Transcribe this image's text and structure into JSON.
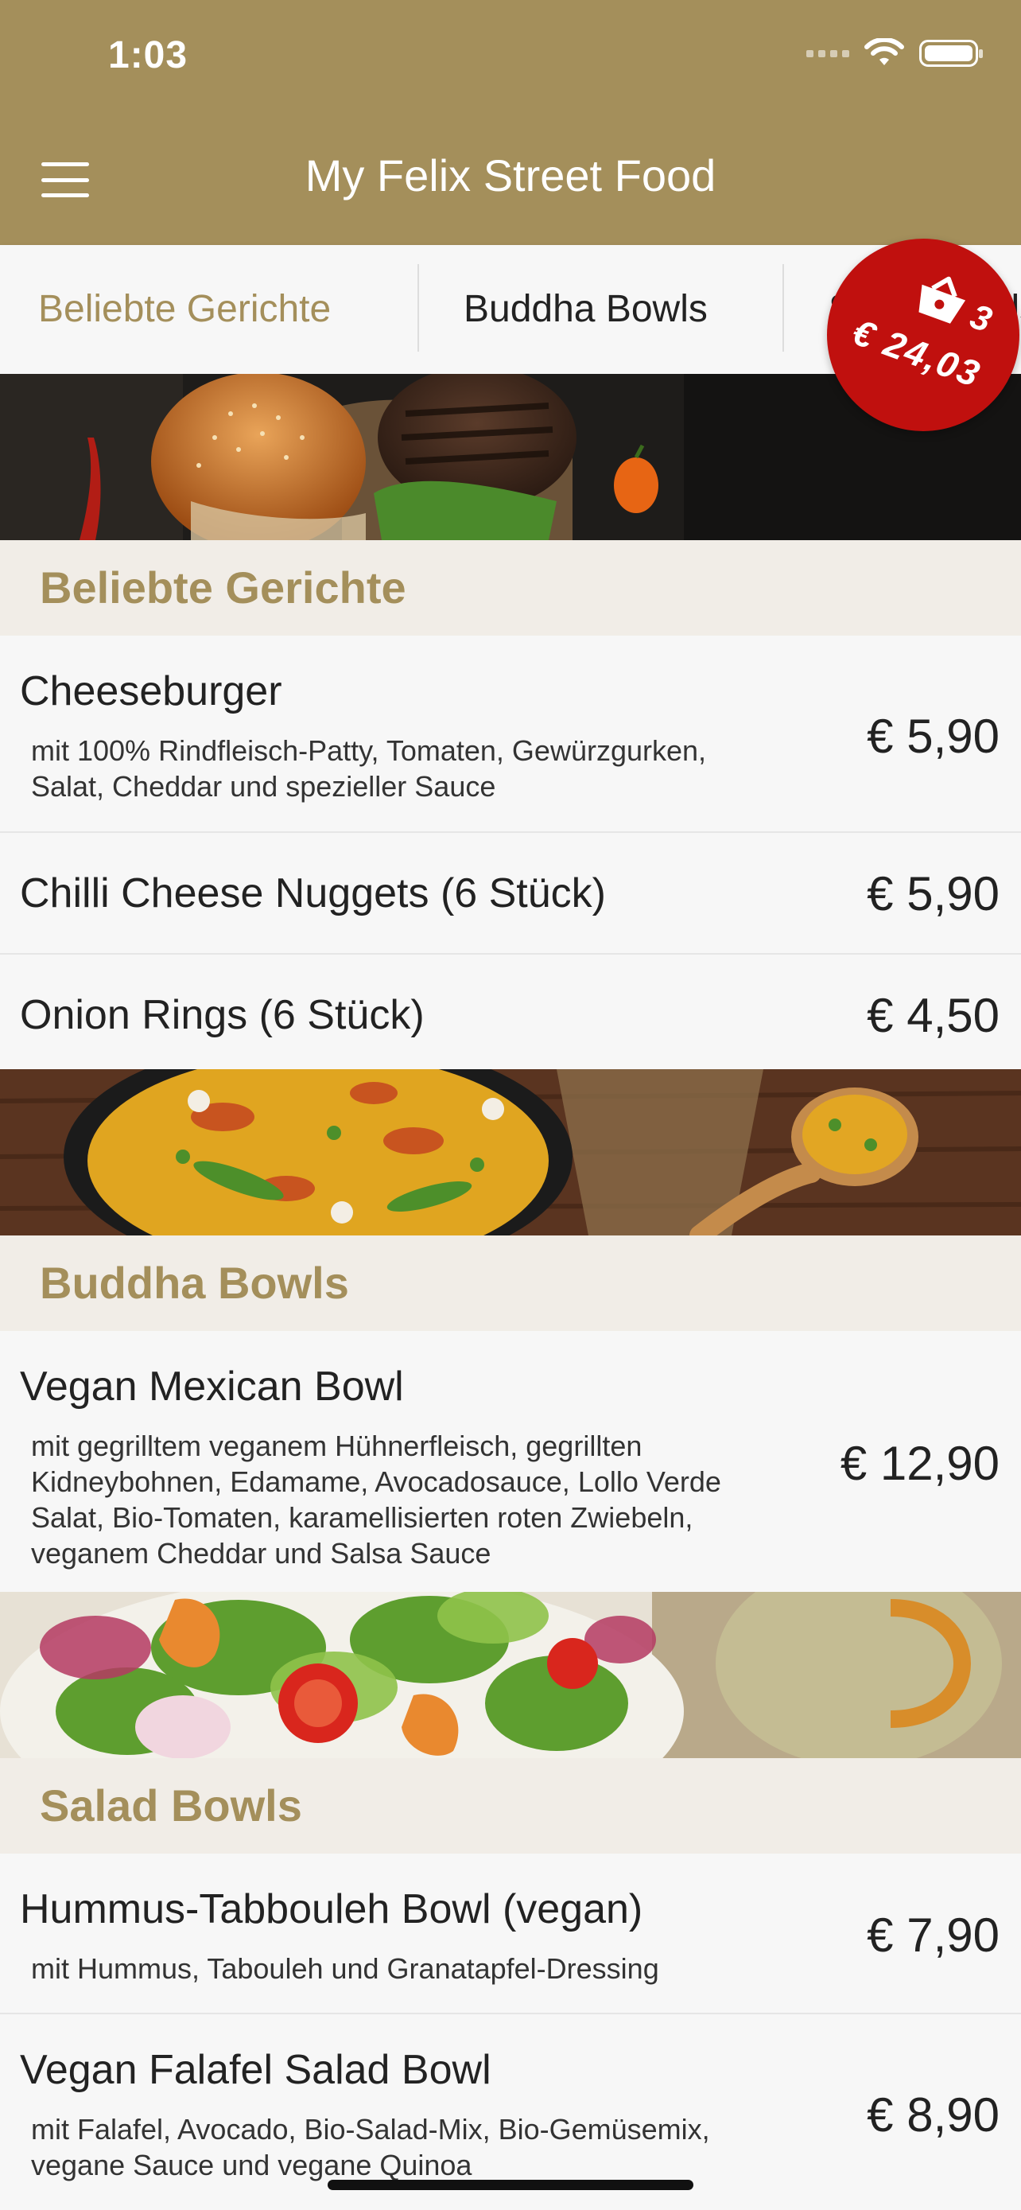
{
  "status_bar": {
    "time": "1:03"
  },
  "header": {
    "title": "My Felix Street Food"
  },
  "tabs": [
    {
      "label": "Beliebte Gerichte",
      "active": true
    },
    {
      "label": "Buddha Bowls"
    },
    {
      "label": "Salad Bowls"
    }
  ],
  "cart": {
    "count": "3",
    "total": "€ 24,03"
  },
  "sections": [
    {
      "title": "Beliebte Gerichte",
      "items": [
        {
          "name": "Cheeseburger",
          "desc": "mit 100% Rindfleisch-Patty, Tomaten, Gewürzgurken, Salat, Cheddar und spezieller Sauce",
          "price": "€ 5,90"
        },
        {
          "name": "Chilli Cheese Nuggets (6 Stück)",
          "price": "€ 5,90"
        },
        {
          "name": "Onion Rings (6 Stück)",
          "price": "€ 4,50"
        }
      ]
    },
    {
      "title": "Buddha Bowls",
      "items": [
        {
          "name": "Vegan Mexican Bowl",
          "desc": "mit gegrilltem veganem Hühnerfleisch, gegrillten Kidneybohnen, Edamame, Avocadosauce, Lollo Verde Salat, Bio-Tomaten, karamellisierten roten Zwiebeln, veganem Cheddar und Salsa Sauce",
          "price": "€ 12,90"
        }
      ]
    },
    {
      "title": "Salad Bowls",
      "items": [
        {
          "name": "Hummus-Tabbouleh Bowl (vegan)",
          "desc": "mit Hummus, Tabouleh und Granatapfel-Dressing",
          "price": "€ 7,90"
        },
        {
          "name": "Vegan Falafel Salad Bowl",
          "desc": "mit Falafel, Avocado, Bio-Salad-Mix, Bio-Gemüsemix, vegane Sauce und vegane Quinoa",
          "price": "€ 8,90"
        }
      ]
    }
  ],
  "colors": {
    "brand": "#a48f5b",
    "cart": "#c0100e",
    "section_bg": "#f1ede7"
  }
}
